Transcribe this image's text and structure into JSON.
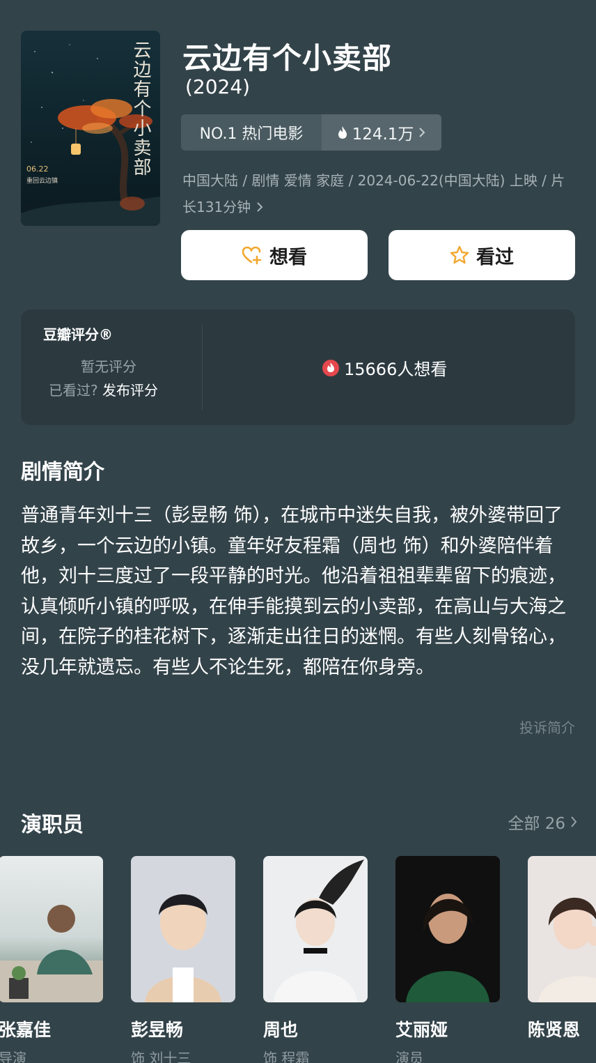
{
  "movie": {
    "title": "云边有个小卖部",
    "year": "(2024)",
    "rank_label": "NO.1 热门电影",
    "heat": "124.1万",
    "meta": "中国大陆 / 剧情 爱情 家庭 / 2024-06-22(中国大陆) 上映 / 片长131分钟",
    "poster_title": "云边有个小卖部",
    "poster_date": "06.22",
    "poster_sub": "重回云边镇"
  },
  "actions": {
    "want_label": "想看",
    "seen_label": "看过"
  },
  "rating": {
    "label": "豆瓣评分®",
    "none_text": "暂无评分",
    "seen_question": "已看过?",
    "publish_label": "发布评分",
    "wish_count": "15666人想看"
  },
  "synopsis": {
    "heading": "剧情简介",
    "text": "普通青年刘十三（彭昱畅 饰），在城市中迷失自我，被外婆带回了故乡，一个云边的小镇。童年好友程霜（周也 饰）和外婆陪伴着他，刘十三度过了一段平静的时光。他沿着祖祖辈辈留下的痕迹，认真倾听小镇的呼吸，在伸手能摸到云的小卖部，在高山与大海之间，在院子的桂花树下，逐渐走出往日的迷惘。有些人刻骨铭心，没几年就遗忘。有些人不论生死，都陪在你身旁。",
    "report_label": "投诉简介"
  },
  "cast": {
    "heading": "演职员",
    "all_label": "全部 26",
    "members": [
      {
        "name": "张嘉佳",
        "role": "导演"
      },
      {
        "name": "彭昱畅",
        "role": "饰 刘十三"
      },
      {
        "name": "周也",
        "role": "饰 程霜"
      },
      {
        "name": "艾丽娅",
        "role": "演员"
      },
      {
        "name": "陈贤恩",
        "role": ""
      }
    ]
  },
  "colors": {
    "background": "#33434a",
    "card": "#2c3a40",
    "accent_orange": "#f2a72e",
    "flame_red": "#e5484d"
  }
}
